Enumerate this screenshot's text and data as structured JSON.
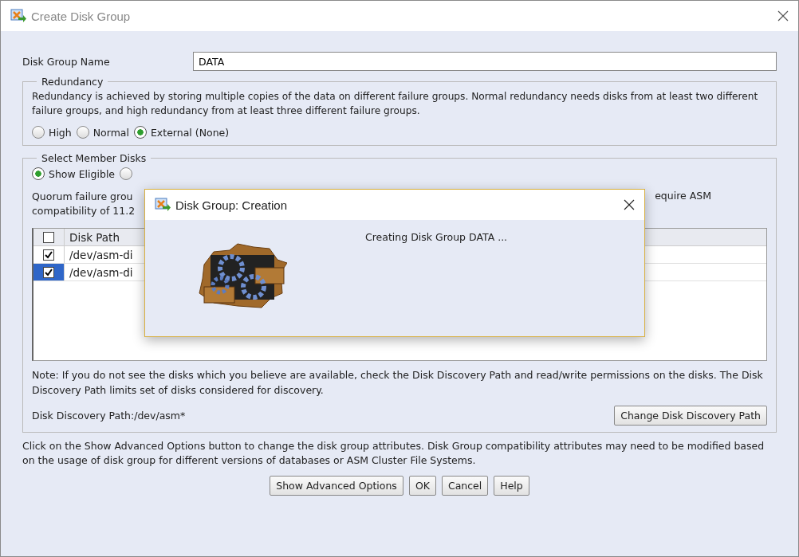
{
  "window": {
    "title": "Create Disk Group"
  },
  "disk_group_name": {
    "label": "Disk Group Name",
    "value": "DATA"
  },
  "redundancy": {
    "legend": "Redundancy",
    "description": "Redundancy is achieved by storing multiple copies of the data on different failure groups. Normal redundancy needs disks from at least two different failure groups, and high redundancy from at least three different failure groups.",
    "options": [
      {
        "label": "High",
        "selected": false
      },
      {
        "label": "Normal",
        "selected": false
      },
      {
        "label": "External (None)",
        "selected": true
      }
    ]
  },
  "member_disks": {
    "legend": "Select Member Disks",
    "filters": [
      {
        "label": "Show Eligible",
        "selected": true
      },
      {
        "selected": false
      }
    ],
    "quorum_note": [
      "Quorum failure grou",
      "compatibility of 11.2"
    ],
    "quorum_note_right": "equire ASM",
    "table": {
      "header_checked": false,
      "columns": [
        "Disk Path"
      ],
      "rows": [
        {
          "path": "/dev/asm-di",
          "checked": true,
          "selected": false
        },
        {
          "path": "/dev/asm-di",
          "checked": true,
          "selected": true
        }
      ]
    },
    "note": "Note: If you do not see the disks which you believe are available, check the Disk Discovery Path and read/write permissions on the disks. The Disk Discovery Path limits set of disks considered for discovery.",
    "discovery_path": "Disk Discovery Path:/dev/asm*",
    "change_button": "Change Disk Discovery Path"
  },
  "advanced_note": "Click on the Show Advanced Options button to change the disk group attributes. Disk Group compatibility attributes may need to be modified based on the usage of disk group for different versions of databases or ASM Cluster File Systems.",
  "buttons": [
    "Show Advanced Options",
    "OK",
    "Cancel",
    "Help"
  ],
  "progress_dialog": {
    "title": "Disk Group: Creation",
    "message": "Creating Disk Group DATA ..."
  }
}
